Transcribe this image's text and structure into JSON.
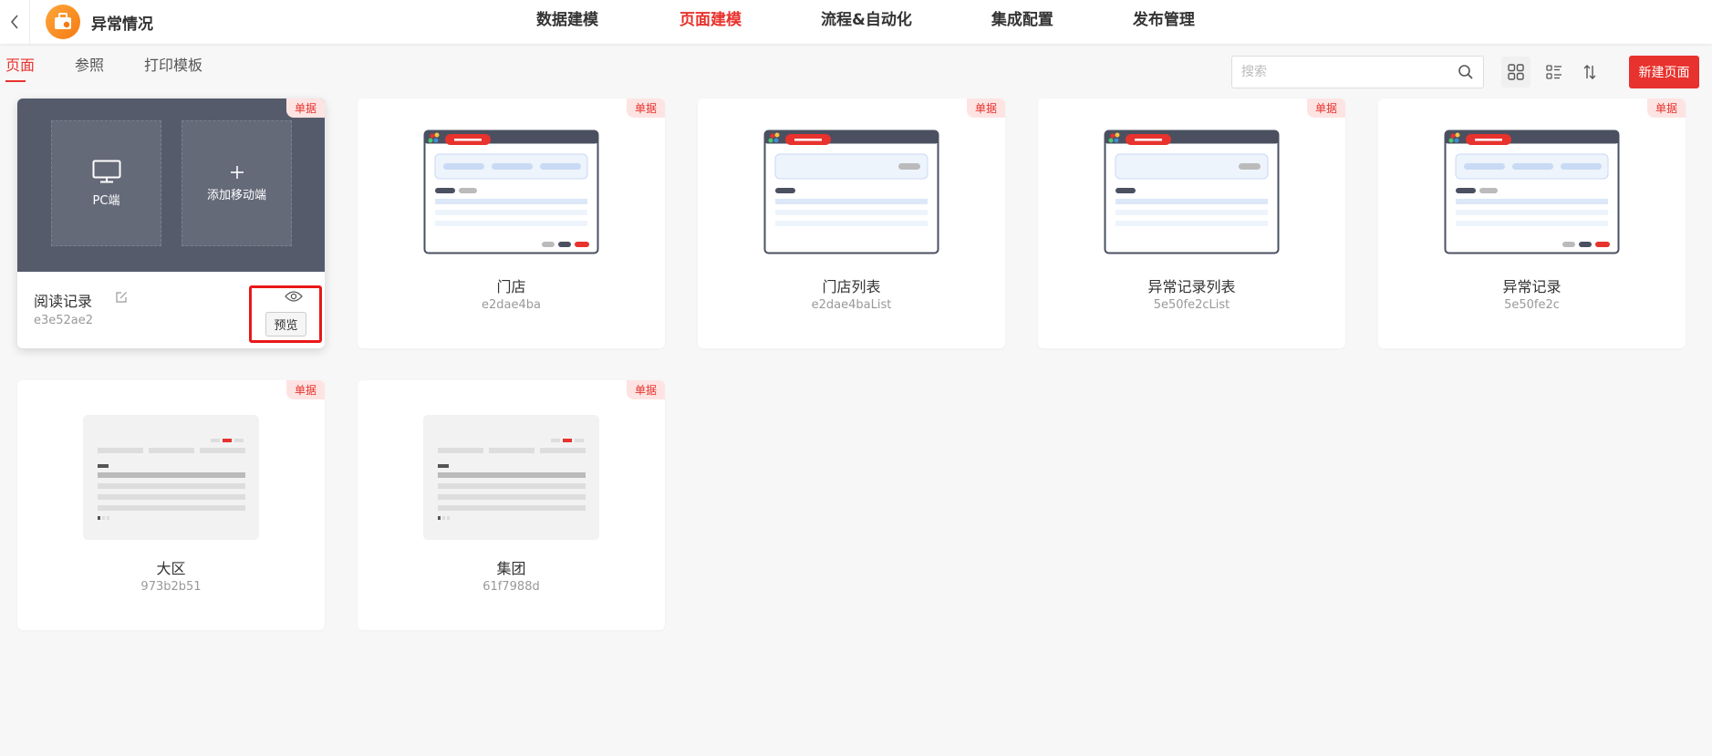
{
  "app": {
    "title": "异常情况",
    "back_icon": "chevron-left-icon"
  },
  "nav": [
    {
      "label": "数据建模",
      "active": false
    },
    {
      "label": "页面建模",
      "active": true
    },
    {
      "label": "流程&自动化",
      "active": false
    },
    {
      "label": "集成配置",
      "active": false
    },
    {
      "label": "发布管理",
      "active": false
    }
  ],
  "subtabs": [
    {
      "label": "页面",
      "active": true
    },
    {
      "label": "参照",
      "active": false
    },
    {
      "label": "打印模板",
      "active": false
    }
  ],
  "search": {
    "placeholder": "搜索",
    "value": ""
  },
  "toolbar": {
    "new_page_label": "新建页面",
    "accent": "#e8322d"
  },
  "cards": [
    {
      "title": "阅读记录",
      "id": "e3e52ae2",
      "badge": "单据",
      "hovered": true,
      "overlay": {
        "pc_label": "PC端",
        "mobile_label": "添加移动端"
      },
      "preview_label": "预览"
    },
    {
      "title": "门店",
      "id": "e2dae4ba",
      "badge": "单据",
      "thumb": "form"
    },
    {
      "title": "门店列表",
      "id": "e2dae4baList",
      "badge": "单据",
      "thumb": "list"
    },
    {
      "title": "异常记录列表",
      "id": "5e50fe2cList",
      "badge": "单据",
      "thumb": "list"
    },
    {
      "title": "异常记录",
      "id": "5e50fe2c",
      "badge": "单据",
      "thumb": "form"
    },
    {
      "title": "大区",
      "id": "973b2b51",
      "badge": "单据",
      "thumb": "grey"
    },
    {
      "title": "集团",
      "id": "61f7988d",
      "badge": "单据",
      "thumb": "grey"
    }
  ]
}
